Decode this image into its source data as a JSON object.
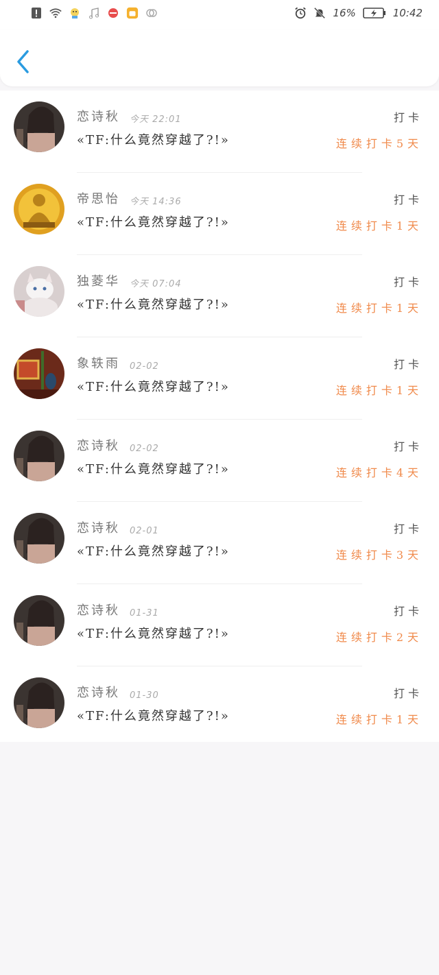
{
  "status_bar": {
    "left_icons": [
      "alert-icon",
      "wifi-icon",
      "app-icon",
      "music-icon",
      "app-icon",
      "app-icon",
      "app-icon"
    ],
    "battery_percent": "16%",
    "time": "10:42"
  },
  "header": {
    "back_icon": "chevron-left-icon"
  },
  "colors": {
    "accent": "#2a9be0",
    "streak": "#f08a4b"
  },
  "items": [
    {
      "name": "恋诗秋",
      "time": "今天 22:01",
      "message": "«TF:什么竟然穿越了?!»",
      "action": "打卡",
      "streak": "连续打卡5天"
    },
    {
      "name": "帝思怡",
      "time": "今天 14:36",
      "message": "«TF:什么竟然穿越了?!»",
      "action": "打卡",
      "streak": "连续打卡1天"
    },
    {
      "name": "独菱华",
      "time": "今天 07:04",
      "message": "«TF:什么竟然穿越了?!»",
      "action": "打卡",
      "streak": "连续打卡1天"
    },
    {
      "name": "象轶雨",
      "time": "02-02",
      "message": "«TF:什么竟然穿越了?!»",
      "action": "打卡",
      "streak": "连续打卡1天"
    },
    {
      "name": "恋诗秋",
      "time": "02-02",
      "message": "«TF:什么竟然穿越了?!»",
      "action": "打卡",
      "streak": "连续打卡4天"
    },
    {
      "name": "恋诗秋",
      "time": "02-01",
      "message": "«TF:什么竟然穿越了?!»",
      "action": "打卡",
      "streak": "连续打卡3天"
    },
    {
      "name": "恋诗秋",
      "time": "01-31",
      "message": "«TF:什么竟然穿越了?!»",
      "action": "打卡",
      "streak": "连续打卡2天"
    },
    {
      "name": "恋诗秋",
      "time": "01-30",
      "message": "«TF:什么竟然穿越了?!»",
      "action": "打卡",
      "streak": "连续打卡1天"
    }
  ]
}
